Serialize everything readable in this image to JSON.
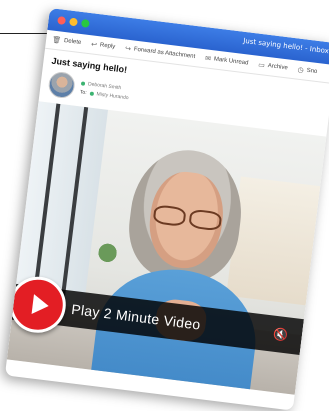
{
  "window": {
    "title": "Just saying hello! - Inbox"
  },
  "toolbar": {
    "items": [
      {
        "label": "Delete",
        "icon": "trash-icon"
      },
      {
        "label": "Reply",
        "icon": "reply-icon"
      },
      {
        "label": "Forward as Attachment",
        "icon": "forward-icon"
      },
      {
        "label": "Mark Unread",
        "icon": "envelope-icon"
      },
      {
        "label": "Archive",
        "icon": "archive-icon"
      },
      {
        "label": "Sno",
        "icon": "clock-icon"
      }
    ]
  },
  "email": {
    "subject": "Just saying hello!",
    "from_name": "Deborah Smith",
    "to_label": "To:",
    "to_name": "Misty Hurando"
  },
  "video": {
    "play_label": "Play 2 Minute Video",
    "mute_icon": "speaker-mute-icon"
  },
  "colors": {
    "titlebar": "#2a63cf",
    "play": "#e31e24",
    "shirt": "#4a90d0"
  }
}
